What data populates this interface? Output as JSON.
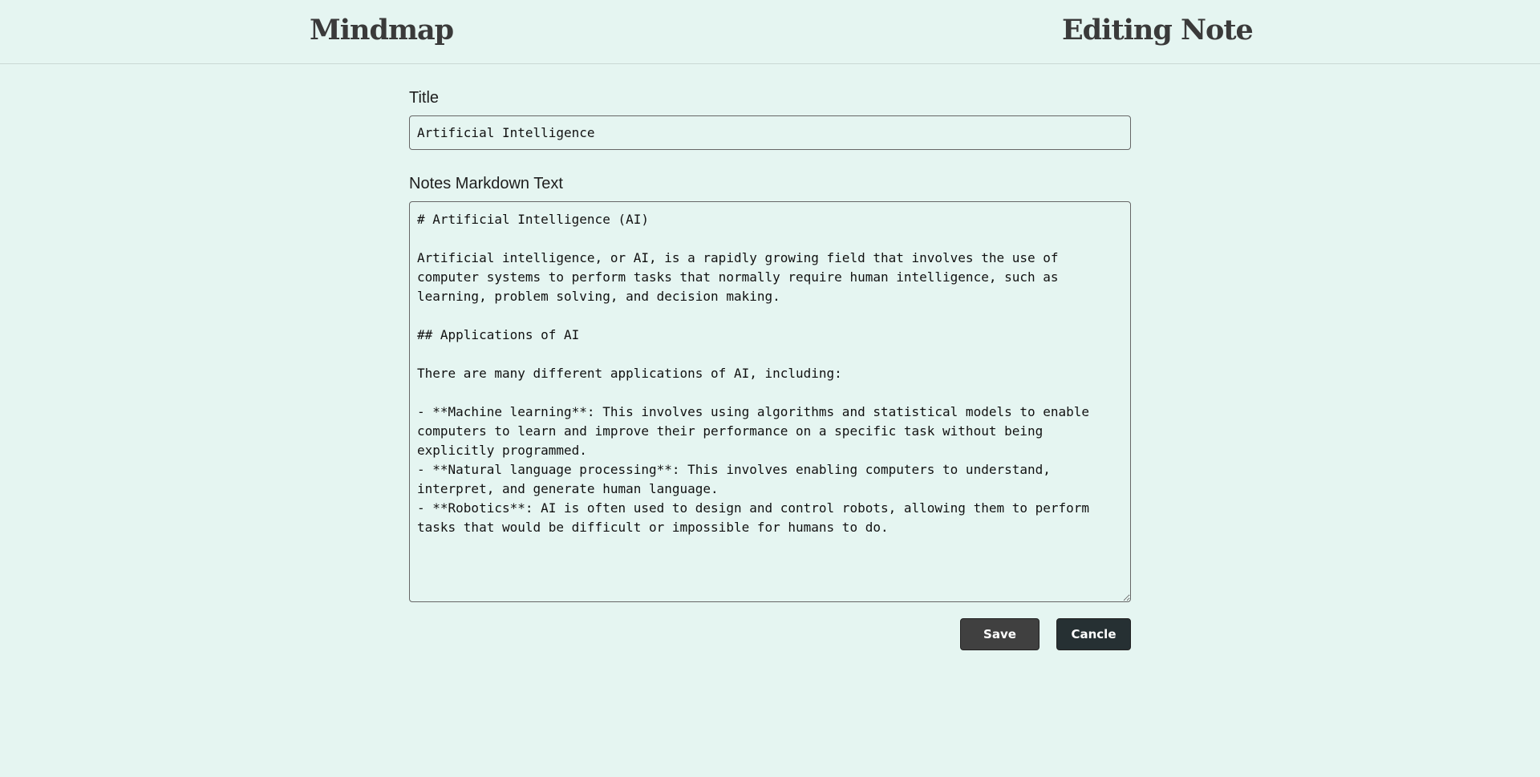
{
  "header": {
    "brand": "Mindmap",
    "page_title": "Editing Note"
  },
  "form": {
    "title_label": "Title",
    "title_value": "Artificial Intelligence",
    "notes_label": "Notes Markdown Text",
    "notes_value": "# Artificial Intelligence (AI)\n\nArtificial intelligence, or AI, is a rapidly growing field that involves the use of computer systems to perform tasks that normally require human intelligence, such as learning, problem solving, and decision making.\n\n## Applications of AI\n\nThere are many different applications of AI, including:\n\n- **Machine learning**: This involves using algorithms and statistical models to enable computers to learn and improve their performance on a specific task without being explicitly programmed.\n- **Natural language processing**: This involves enabling computers to understand, interpret, and generate human language.\n- **Robotics**: AI is often used to design and control robots, allowing them to perform tasks that would be difficult or impossible for humans to do."
  },
  "actions": {
    "save_label": "Save",
    "cancel_label": "Cancle"
  },
  "colors": {
    "background": "#e5f5f1",
    "save_button": "#404040",
    "cancel_button": "#263033"
  }
}
